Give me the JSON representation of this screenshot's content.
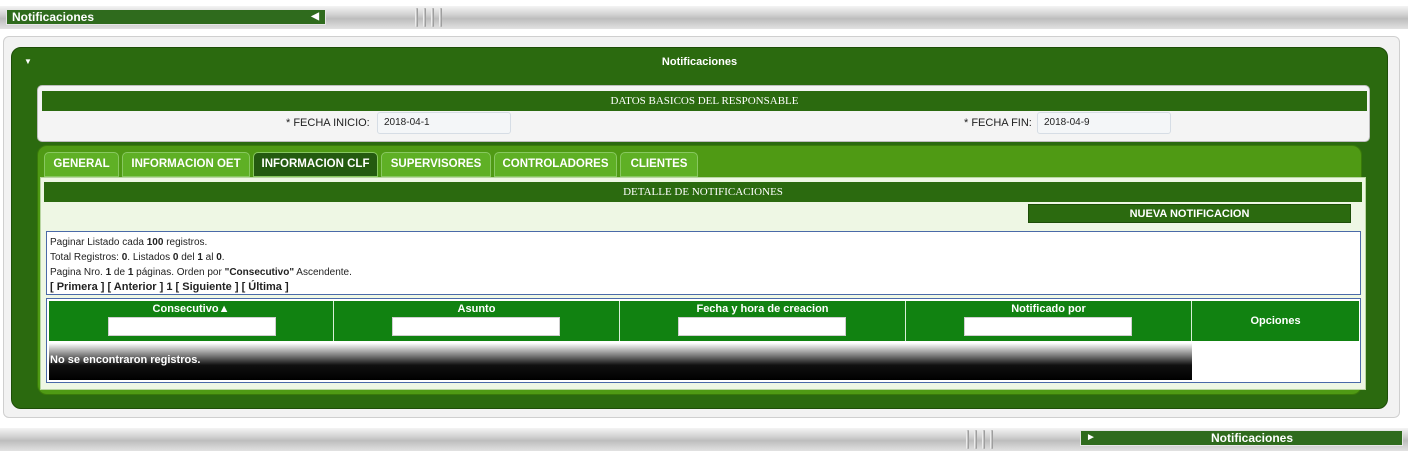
{
  "top_bar": {
    "title": "Notificaciones",
    "arrow": "◀"
  },
  "bottom_bar": {
    "title": "Notificaciones",
    "arrow": "►"
  },
  "panel": {
    "title": "Notificaciones",
    "toggle": "▼"
  },
  "datos_basicos": {
    "title": "DATOS BASICOS DEL RESPONSABLE",
    "fecha_inicio_label": "* FECHA INICIO:",
    "fecha_inicio_value": "2018-04-1",
    "fecha_fin_label": "* FECHA FIN:",
    "fecha_fin_value": "2018-04-9"
  },
  "tabs": [
    {
      "label": "GENERAL",
      "active": false
    },
    {
      "label": "INFORMACION OET",
      "active": false
    },
    {
      "label": "INFORMACION CLF",
      "active": true
    },
    {
      "label": "SUPERVISORES",
      "active": false
    },
    {
      "label": "CONTROLADORES",
      "active": false
    },
    {
      "label": "CLIENTES",
      "active": false
    }
  ],
  "detalle": {
    "title": "DETALLE DE NOTIFICACIONES",
    "nueva_button": "NUEVA NOTIFICACION"
  },
  "paginacion": {
    "line1_pre": "Paginar Listado cada ",
    "per_page": "100",
    "line1_post": " registros.",
    "line2_pre": "Total Registros: ",
    "total": "0",
    "line2_mid1": ". Listados ",
    "from": "0",
    "line2_mid2": " del ",
    "to": "1",
    "line2_mid3": " al ",
    "of": "0",
    "line2_post": ".",
    "line3_pre": "Pagina Nro. ",
    "page": "1",
    "line3_mid1": " de ",
    "pages": "1",
    "line3_mid2": " páginas. Orden por ",
    "order_field": "\"Consecutivo\"",
    "line3_post": " Ascendente.",
    "nav_first": "[ Primera ]",
    "nav_prev": "[ Anterior ]",
    "nav_current": "1",
    "nav_next": "[ Siguiente ]",
    "nav_last": "[ Última ]"
  },
  "table": {
    "columns": [
      "Consecutivo",
      "Asunto",
      "Fecha y hora de creacion",
      "Notificado por",
      "Opciones"
    ],
    "sort_indicator": "▲",
    "empty_message": "No se encontraron registros."
  }
}
